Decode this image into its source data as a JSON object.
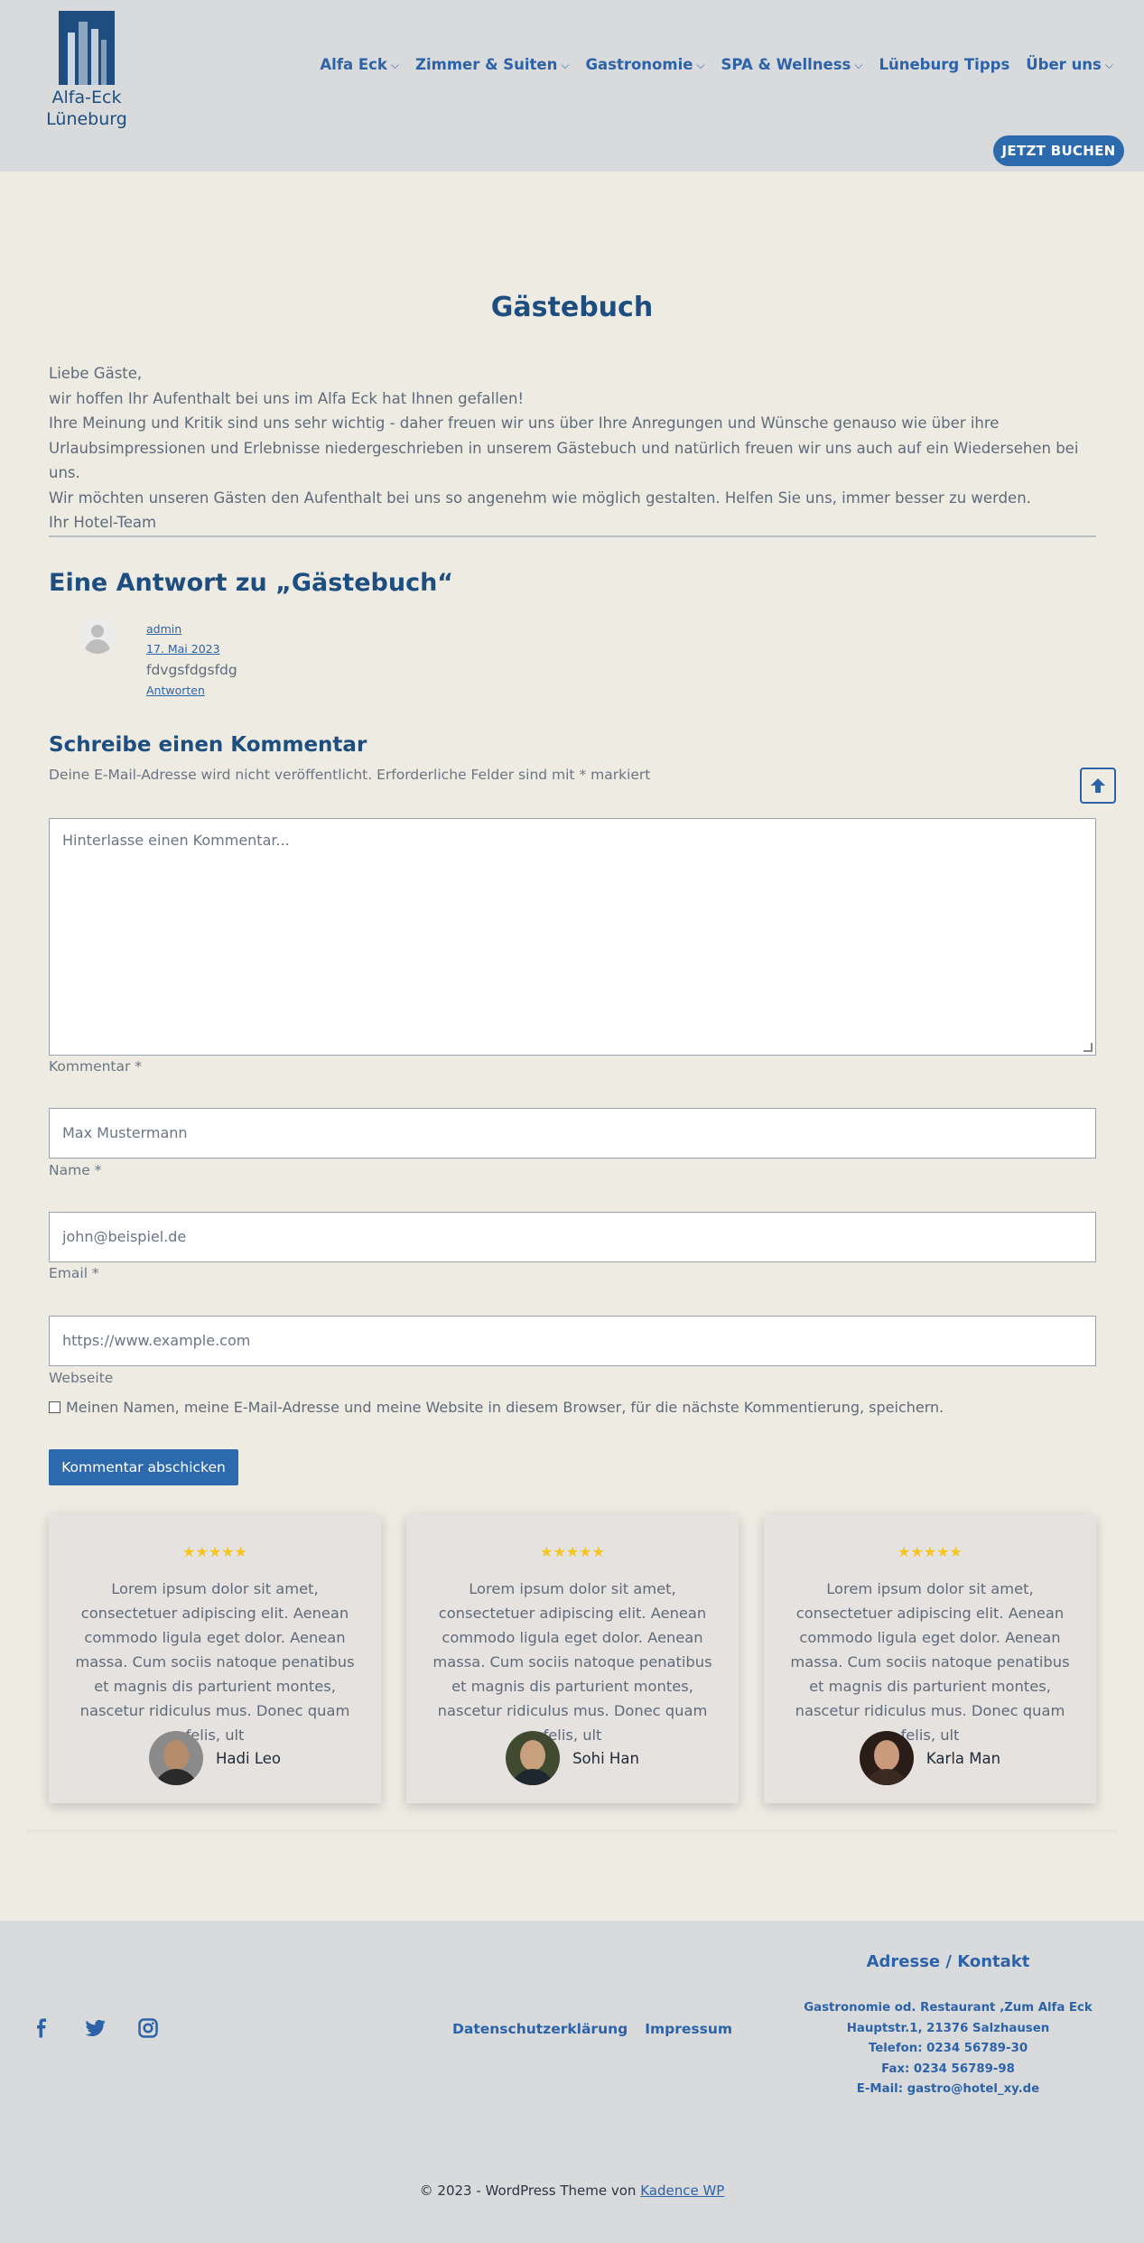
{
  "header": {
    "logo_line1": "Alfa-Eck",
    "logo_line2": "Lüneburg",
    "nav": [
      {
        "label": "Alfa Eck",
        "has_dropdown": true
      },
      {
        "label": "Zimmer & Suiten",
        "has_dropdown": true
      },
      {
        "label": "Gastronomie",
        "has_dropdown": true
      },
      {
        "label": "SPA & Wellness",
        "has_dropdown": true
      },
      {
        "label": "Lüneburg Tipps",
        "has_dropdown": false
      },
      {
        "label": "Über uns",
        "has_dropdown": true
      }
    ],
    "book_button": "JETZT BUCHEN"
  },
  "main": {
    "title": "Gästebuch",
    "intro": [
      "Liebe Gäste,",
      "wir hoffen Ihr Aufenthalt bei uns im Alfa Eck hat Ihnen gefallen!",
      "Ihre Meinung und Kritik sind uns sehr wichtig - daher freuen wir uns über Ihre Anregungen und Wünsche genauso wie über ihre Urlaubsimpressionen und Erlebnisse niedergeschrieben in unserem Gästebuch und natürlich freuen wir uns auch auf ein Wiedersehen bei uns.",
      "Wir möchten unseren Gästen den Aufenthalt bei uns so angenehm wie möglich gestalten. Helfen Sie uns, immer besser zu werden.",
      "Ihr Hotel-Team"
    ]
  },
  "comments": {
    "heading": "Eine Antwort zu „Gästebuch“",
    "items": [
      {
        "author": "admin",
        "date": "17. Mai 2023",
        "text": "fdvgsfdgsfdg",
        "reply": "Antworten"
      }
    ]
  },
  "form": {
    "heading": "Schreibe einen Kommentar",
    "note": "Deine E-Mail-Adresse wird nicht veröffentlicht. Erforderliche Felder sind mit * markiert",
    "comment_placeholder": "Hinterlasse einen Kommentar...",
    "comment_label": "Kommentar *",
    "name_placeholder": "Max Mustermann",
    "name_label": "Name *",
    "email_placeholder": "john@beispiel.de",
    "email_label": "Email *",
    "website_placeholder": "https://www.example.com",
    "website_label": "Webseite",
    "consent": "Meinen Namen, meine E-Mail-Adresse und meine Website in diesem Browser, für die nächste Kommentierung, speichern.",
    "consent_checked": false,
    "submit": "Kommentar abschicken"
  },
  "testimonials": [
    {
      "rating": 5,
      "stars": "★★★★★",
      "text": "Lorem ipsum dolor sit amet, consectetuer adipiscing elit. Aenean commodo ligula eget dolor. Aenean massa. Cum sociis natoque penatibus et magnis dis parturient montes, nascetur ridiculus mus. Donec quam felis, ult",
      "name": "Hadi Leo",
      "face_color": "#b58c6c",
      "bg_color": "#8a8a8a"
    },
    {
      "rating": 5,
      "stars": "★★★★★",
      "text": "Lorem ipsum dolor sit amet, consectetuer adipiscing elit. Aenean commodo ligula eget dolor. Aenean massa. Cum sociis natoque penatibus et magnis dis parturient montes, nascetur ridiculus mus. Donec quam felis, ult",
      "name": "Sohi Han",
      "face_color": "#c9a07e",
      "bg_color": "#3f4a30"
    },
    {
      "rating": 5,
      "stars": "★★★★★",
      "text": "Lorem ipsum dolor sit amet, consectetuer adipiscing elit. Aenean commodo ligula eget dolor. Aenean massa. Cum sociis natoque penatibus et magnis dis parturient montes, nascetur ridiculus mus. Donec quam felis, ult",
      "name": "Karla Man",
      "face_color": "#c99a7c",
      "bg_color": "#2a1c16"
    }
  ],
  "footer": {
    "social": [
      "facebook-icon",
      "twitter-icon",
      "instagram-icon"
    ],
    "links": [
      "Datenschutzerklärung",
      "Impressum"
    ],
    "address_title": "Adresse / Kontakt",
    "address_lines": [
      "Gastronomie od. Restaurant ‚Zum Alfa Eck",
      "Hauptstr.1, 21376 Salzhausen",
      "Telefon: 0234 56789-30",
      "Fax: 0234 56789-98",
      "E-Mail: gastro@hotel_xy.de"
    ],
    "copyright_prefix": "© 2023 - WordPress Theme von",
    "copyright_link": "Kadence WP"
  },
  "colors": {
    "brand_blue": "#1d4e7f",
    "link_blue": "#2c63a8",
    "button_blue": "#2d6aad",
    "page_bg": "#eeebe3",
    "header_bg": "#d9dadc",
    "star": "#f3c622"
  }
}
